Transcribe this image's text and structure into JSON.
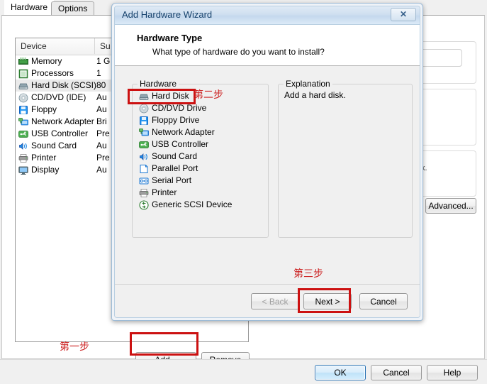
{
  "bg_window": {
    "tabs": [
      {
        "label": "Hardware",
        "active": true
      },
      {
        "label": "Options",
        "active": false
      }
    ],
    "device_table": {
      "columns": [
        "Device",
        "Su"
      ],
      "rows": [
        {
          "icon": "memory-icon",
          "name": "Memory",
          "summary": "1 G",
          "selected": false
        },
        {
          "icon": "processor-icon",
          "name": "Processors",
          "summary": "1",
          "selected": false
        },
        {
          "icon": "harddisk-icon",
          "name": "Hard Disk (SCSI)",
          "summary": "80",
          "selected": true
        },
        {
          "icon": "cddvd-icon",
          "name": "CD/DVD (IDE)",
          "summary": "Au",
          "selected": false
        },
        {
          "icon": "floppy-icon",
          "name": "Floppy",
          "summary": "Au",
          "selected": false
        },
        {
          "icon": "network-adapter-icon",
          "name": "Network Adapter",
          "summary": "Bri",
          "selected": false
        },
        {
          "icon": "usb-controller-icon",
          "name": "USB Controller",
          "summary": "Pre",
          "selected": false
        },
        {
          "icon": "sound-card-icon",
          "name": "Sound Card",
          "summary": "Au",
          "selected": false
        },
        {
          "icon": "printer-icon",
          "name": "Printer",
          "summary": "Pre",
          "selected": false
        },
        {
          "icon": "display-icon",
          "name": "Display",
          "summary": "Au",
          "selected": false
        }
      ]
    },
    "right_panel": {
      "partial_text": "k."
    },
    "advanced_label": "Advanced...",
    "add_label": "Add...",
    "remove_label": "Remove",
    "ok_label": "OK",
    "cancel_label": "Cancel",
    "help_label": "Help"
  },
  "wizard": {
    "title": "Add Hardware Wizard",
    "close_glyph": "✕",
    "header_title": "Hardware Type",
    "header_subtitle": "What type of hardware do you want to install?",
    "hardware_group_label": "Hardware",
    "explanation_group_label": "Explanation",
    "explanation_text": "Add a hard disk.",
    "hardware_items": [
      {
        "icon": "harddisk-icon",
        "name": "Hard Disk",
        "selected": true
      },
      {
        "icon": "cddvd-icon",
        "name": "CD/DVD Drive",
        "selected": false
      },
      {
        "icon": "floppy-icon",
        "name": "Floppy Drive",
        "selected": false
      },
      {
        "icon": "network-adapter-icon",
        "name": "Network Adapter",
        "selected": false
      },
      {
        "icon": "usb-controller-icon",
        "name": "USB Controller",
        "selected": false
      },
      {
        "icon": "sound-card-icon",
        "name": "Sound Card",
        "selected": false
      },
      {
        "icon": "parallel-port-icon",
        "name": "Parallel Port",
        "selected": false
      },
      {
        "icon": "serial-port-icon",
        "name": "Serial Port",
        "selected": false
      },
      {
        "icon": "printer-icon",
        "name": "Printer",
        "selected": false
      },
      {
        "icon": "scsi-device-icon",
        "name": "Generic SCSI Device",
        "selected": false
      }
    ],
    "back_label": "< Back",
    "next_label": "Next >",
    "cancel_label": "Cancel"
  },
  "annotations": {
    "step1": "第一步",
    "step2": "第二步",
    "step3": "第三步",
    "color": "#cc2222",
    "highlight_color": "#cc1111"
  }
}
